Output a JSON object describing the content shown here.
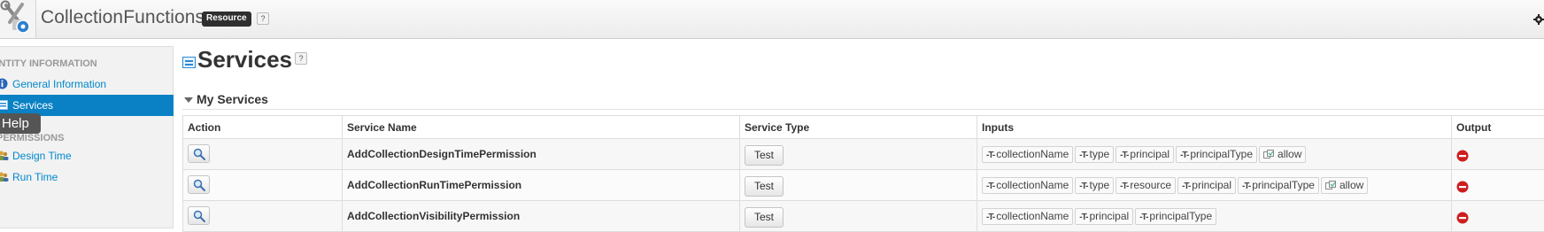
{
  "header": {
    "app_title": "CollectionFunctions",
    "badge": "Resource",
    "help": "?",
    "settings_icon": "gear-icon"
  },
  "sidebar": {
    "heading_entity": "ENTITY INFORMATION",
    "heading_permissions": "PERMISSIONS",
    "items": [
      {
        "label": "General Information",
        "icon": "info-icon"
      },
      {
        "label": "Services",
        "icon": "services-icon"
      },
      {
        "label": "Design Time",
        "icon": "users-icon"
      },
      {
        "label": "Run Time",
        "icon": "users-icon"
      }
    ],
    "tooltip": "Help"
  },
  "main": {
    "page_title": "Services",
    "page_help": "?",
    "section_title": "My Services",
    "table": {
      "headers": [
        "Action",
        "Service Name",
        "Service Type",
        "Inputs",
        "Output"
      ],
      "rows": [
        {
          "name": "AddCollectionDesignTimePermission",
          "type": "Test",
          "inputs": [
            {
              "label": "collectionName",
              "kind": "text"
            },
            {
              "label": "type",
              "kind": "text"
            },
            {
              "label": "principal",
              "kind": "text"
            },
            {
              "label": "principalType",
              "kind": "text"
            },
            {
              "label": "allow",
              "kind": "boolean"
            }
          ]
        },
        {
          "name": "AddCollectionRunTimePermission",
          "type": "Test",
          "inputs": [
            {
              "label": "collectionName",
              "kind": "text"
            },
            {
              "label": "type",
              "kind": "text"
            },
            {
              "label": "resource",
              "kind": "text"
            },
            {
              "label": "principal",
              "kind": "text"
            },
            {
              "label": "principalType",
              "kind": "text"
            },
            {
              "label": "allow",
              "kind": "boolean"
            }
          ]
        },
        {
          "name": "AddCollectionVisibilityPermission",
          "type": "Test",
          "inputs": [
            {
              "label": "collectionName",
              "kind": "text"
            },
            {
              "label": "principal",
              "kind": "text"
            },
            {
              "label": "principalType",
              "kind": "text"
            }
          ]
        }
      ]
    }
  },
  "colors": {
    "accent": "#0a81c4",
    "link": "#0088cc",
    "output_nothing": "#cc1f1f"
  }
}
